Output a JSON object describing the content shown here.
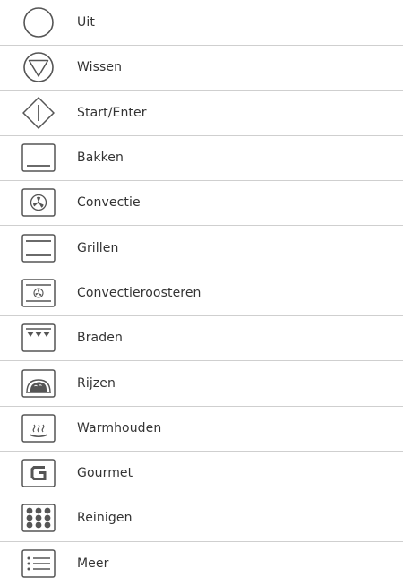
{
  "legend": {
    "rows": [
      {
        "icon": "off-circle-icon",
        "label": "Uit"
      },
      {
        "icon": "clear-triangle-icon",
        "label": "Wissen"
      },
      {
        "icon": "start-diamond-icon",
        "label": "Start/Enter"
      },
      {
        "icon": "bake-icon",
        "label": "Bakken"
      },
      {
        "icon": "convection-fan-icon",
        "label": "Convectie"
      },
      {
        "icon": "grill-icon",
        "label": "Grillen"
      },
      {
        "icon": "convection-roast-icon",
        "label": "Convectieroosteren"
      },
      {
        "icon": "broil-icon",
        "label": "Braden"
      },
      {
        "icon": "proof-bread-icon",
        "label": "Rijzen"
      },
      {
        "icon": "keep-warm-icon",
        "label": "Warmhouden"
      },
      {
        "icon": "gourmet-icon",
        "label": "Gourmet"
      },
      {
        "icon": "self-clean-icon",
        "label": "Reinigen"
      },
      {
        "icon": "more-list-icon",
        "label": "Meer"
      }
    ]
  },
  "colors": {
    "icon_stroke": "#555555",
    "text": "#333333",
    "divider": "#cfcfcf"
  }
}
